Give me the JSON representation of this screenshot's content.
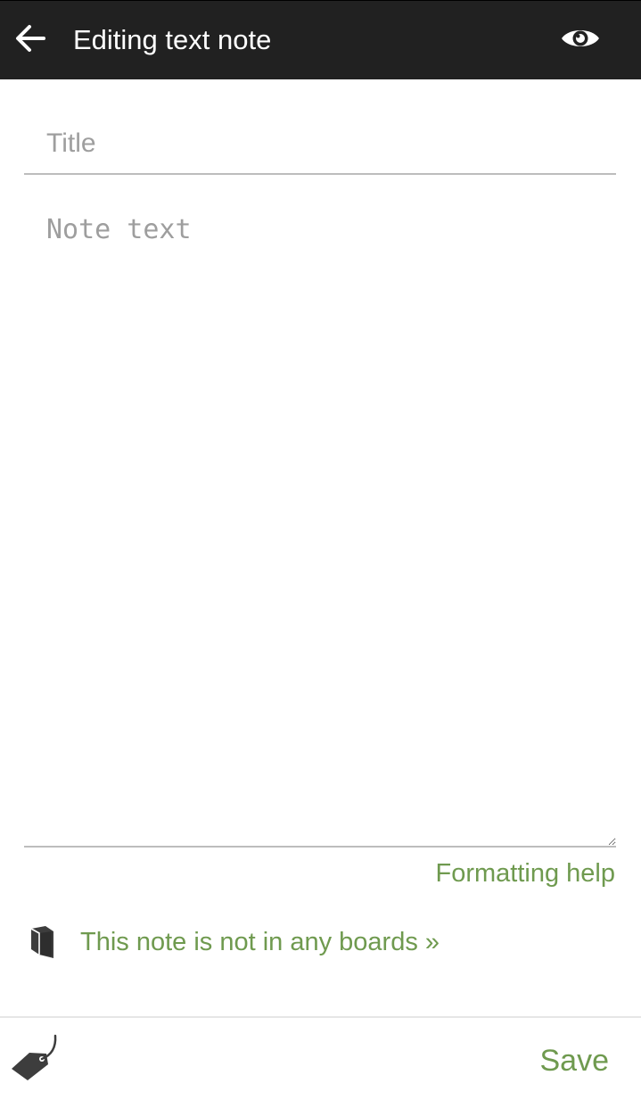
{
  "header": {
    "title": "Editing text note",
    "back_icon": "arrow-left-icon",
    "preview_icon": "eye-icon",
    "background_color": "#212121"
  },
  "form": {
    "title_placeholder": "Title",
    "title_value": "",
    "note_placeholder": "Note text",
    "note_value": "",
    "formatting_help_label": "Formatting help"
  },
  "boards": {
    "icon": "book-icon",
    "label": "This note is not in any boards »"
  },
  "footer": {
    "tag_icon": "tag-icon",
    "save_label": "Save"
  },
  "colors": {
    "accent": "#6f9a4f",
    "icon_dark": "#3d3d3d",
    "placeholder": "#9e9e9e"
  }
}
